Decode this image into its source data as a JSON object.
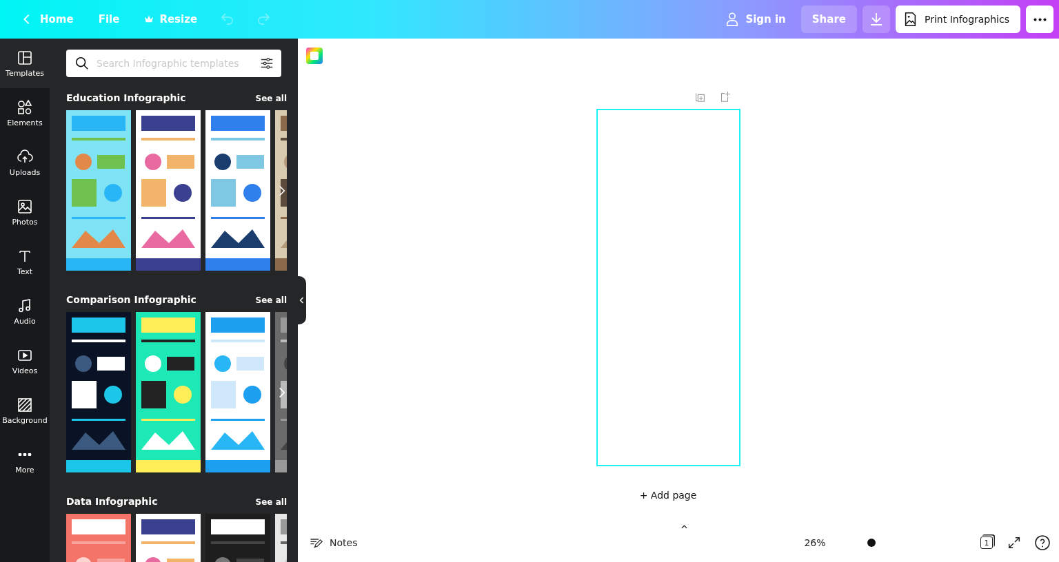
{
  "topbar": {
    "back": "Home",
    "menu": [
      {
        "kind": "file",
        "label": "File"
      },
      {
        "kind": "resize",
        "label": "Resize"
      }
    ],
    "history": [
      {
        "kind": "undo",
        "disabled": true
      },
      {
        "kind": "redo",
        "disabled": true
      }
    ],
    "sign_in": "Sign in",
    "share": "Share",
    "print": "Print Infographics"
  },
  "rail": [
    {
      "kind": "templates",
      "label": "Templates",
      "selected": true
    },
    {
      "kind": "elements",
      "label": "Elements",
      "selected": false
    },
    {
      "kind": "uploads",
      "label": "Uploads",
      "selected": false
    },
    {
      "kind": "photos",
      "label": "Photos",
      "selected": false
    },
    {
      "kind": "text",
      "label": "Text",
      "selected": false
    },
    {
      "kind": "audio",
      "label": "Audio",
      "selected": false
    },
    {
      "kind": "videos",
      "label": "Videos",
      "selected": false
    },
    {
      "kind": "background",
      "label": "Background",
      "selected": false
    },
    {
      "kind": "more",
      "label": "More",
      "selected": false
    }
  ],
  "search": {
    "placeholder": "Search Infographic templates"
  },
  "sections": [
    {
      "title": "Education Infographic",
      "see_all": "See all"
    },
    {
      "title": "Comparison Infographic",
      "see_all": "See all"
    },
    {
      "title": "Data Infographic",
      "see_all": "See all"
    }
  ],
  "canvas": {
    "add_page": "+ Add page"
  },
  "footer": {
    "notes": "Notes",
    "zoom": "26%",
    "page_count": "1"
  }
}
